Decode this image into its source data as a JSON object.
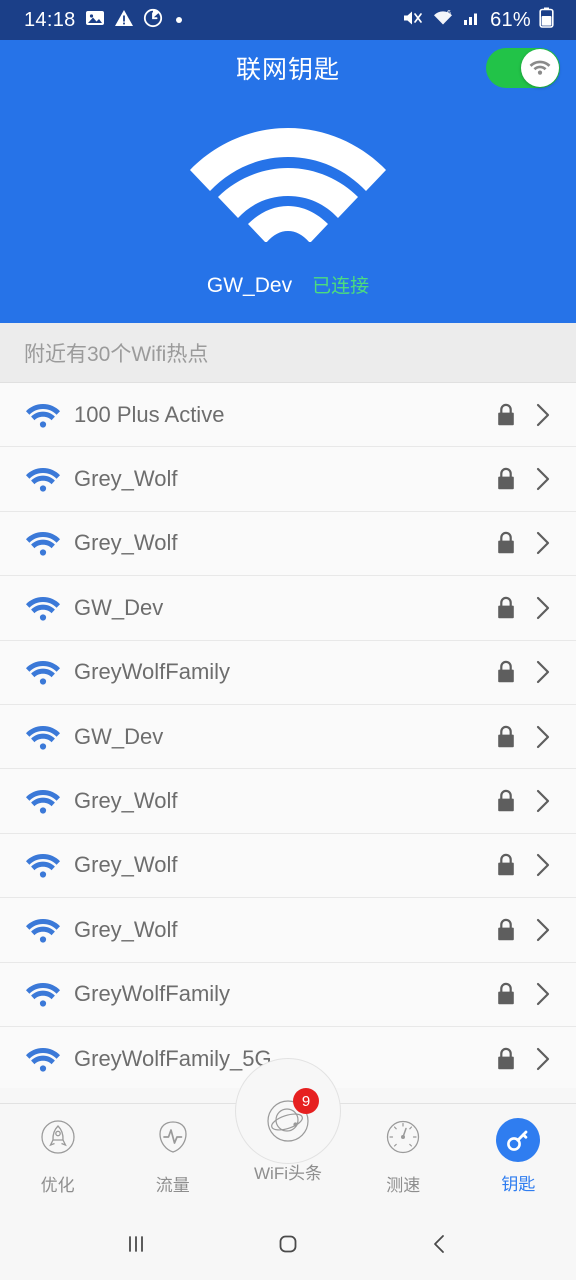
{
  "statusbar": {
    "time": "14:18",
    "battery_percent": "61%",
    "left_icons": [
      "photo-icon",
      "warning-triangle-icon",
      "alarm-clock-icon",
      "dot-indicator"
    ],
    "right_icons": [
      "mute-icon",
      "wifi-signal-icon",
      "cellular-signal-icon",
      "battery-icon"
    ],
    "background": "#1b3f88"
  },
  "header": {
    "title": "联网钥匙",
    "toggle_on": true,
    "toggle_color": "#22c348",
    "toggle_icon": "wifi-icon",
    "hero_icon": "wifi-large-icon",
    "connected_ssid": "GW_Dev",
    "connected_state": "已连接",
    "state_color": "#4cdc7e",
    "background": "#2673e8"
  },
  "section": {
    "label": "附近有30个Wifi热点",
    "hotspot_count": "30"
  },
  "list": {
    "rows": [
      {
        "name": "100 Plus Active",
        "signal": "wifi-icon",
        "secured": true
      },
      {
        "name": "Grey_Wolf",
        "signal": "wifi-icon",
        "secured": true
      },
      {
        "name": "Grey_Wolf",
        "signal": "wifi-icon",
        "secured": true
      },
      {
        "name": "GW_Dev",
        "signal": "wifi-icon",
        "secured": true
      },
      {
        "name": "GreyWolfFamily",
        "signal": "wifi-icon",
        "secured": true
      },
      {
        "name": "GW_Dev",
        "signal": "wifi-icon",
        "secured": true
      },
      {
        "name": "Grey_Wolf",
        "signal": "wifi-icon",
        "secured": true
      },
      {
        "name": "Grey_Wolf",
        "signal": "wifi-icon",
        "secured": true
      },
      {
        "name": "Grey_Wolf",
        "signal": "wifi-icon",
        "secured": true
      },
      {
        "name": "GreyWolfFamily",
        "signal": "wifi-icon",
        "secured": true
      },
      {
        "name": "GreyWolfFamily_5G",
        "signal": "wifi-icon",
        "secured": true
      }
    ]
  },
  "tabbar": {
    "active_color": "#2f7df0",
    "inactive_color": "#8e8e8e",
    "tabs": [
      {
        "label": "优化",
        "icon": "rocket-icon",
        "active": false
      },
      {
        "label": "流量",
        "icon": "pulse-icon",
        "active": false
      },
      {
        "label": "WiFi头条",
        "icon": "planet-icon",
        "active": false,
        "badge": "9"
      },
      {
        "label": "测速",
        "icon": "speedometer-icon",
        "active": false
      },
      {
        "label": "钥匙",
        "icon": "key-icon",
        "active": true
      }
    ]
  },
  "navbar": {
    "recents": "recents-icon",
    "home": "home-icon",
    "back": "back-icon"
  }
}
